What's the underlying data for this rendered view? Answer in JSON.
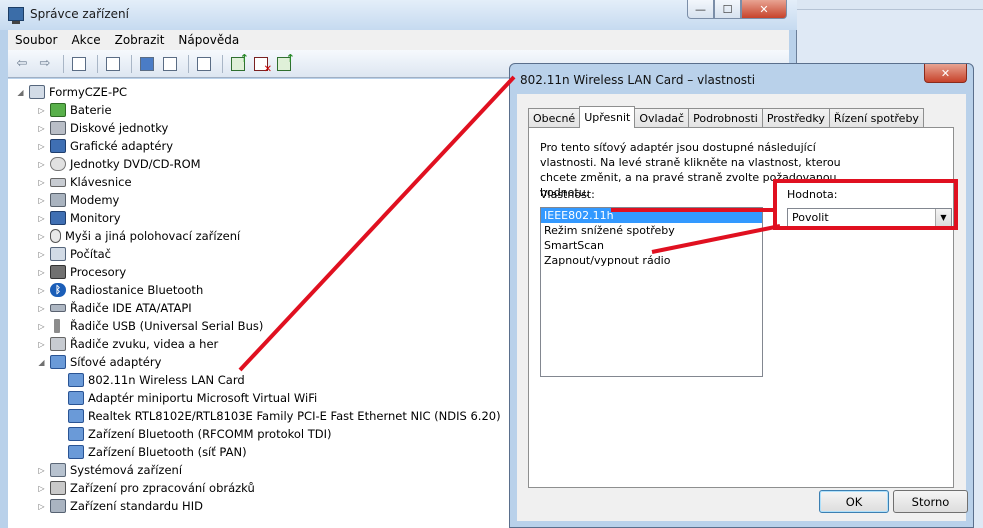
{
  "main_window": {
    "title": "Správce zařízení",
    "caption_buttons": {
      "minimize": "—",
      "maximize": "☐",
      "close": "✕"
    },
    "menu": [
      "Soubor",
      "Akce",
      "Zobrazit",
      "Nápověda"
    ],
    "toolbar_icons": [
      "back-arrow-icon",
      "forward-arrow-icon",
      "tree-view-icon",
      "properties-icon",
      "help-icon",
      "device-view-icon",
      "scan-hardware-icon",
      "update-driver-icon",
      "uninstall-icon",
      "enable-device-icon"
    ],
    "tree": {
      "root": "FormyCZE-PC",
      "categories": [
        "Baterie",
        "Diskové jednotky",
        "Grafické adaptéry",
        "Jednotky DVD/CD-ROM",
        "Klávesnice",
        "Modemy",
        "Monitory",
        "Myši a jiná polohovací zařízení",
        "Počítač",
        "Procesory",
        "Radiostanice Bluetooth",
        "Řadiče IDE ATA/ATAPI",
        "Řadiče USB (Universal Serial Bus)",
        "Řadiče zvuku, videa a her",
        "Síťové adaptéry"
      ],
      "network_children": [
        "802.11n Wireless LAN Card",
        "Adaptér miniportu Microsoft Virtual WiFi",
        "Realtek RTL8102E/RTL8103E Family PCI-E Fast Ethernet NIC (NDIS 6.20)",
        "Zařízení Bluetooth (RFCOMM protokol TDI)",
        "Zařízení Bluetooth (síť PAN)"
      ],
      "tail_categories": [
        "Systémová zařízení",
        "Zařízení pro zpracování obrázků",
        "Zařízení standardu HID"
      ]
    }
  },
  "dialog": {
    "title": "802.11n Wireless LAN Card – vlastnosti",
    "close_label": "✕",
    "tabs": [
      "Obecné",
      "Upřesnit",
      "Ovladač",
      "Podrobnosti",
      "Prostředky",
      "Řízení spotřeby"
    ],
    "active_tab": "Upřesnit",
    "description": "Pro tento síťový adaptér jsou dostupné následující vlastnosti. Na levé straně klikněte na vlastnost, kterou chcete změnit, a na pravé straně zvolte požadovanou hodnotu.",
    "property_label": "Vlastnost:",
    "properties": [
      "IEEE802.11h",
      "Režim snížené spotřeby",
      "SmartScan",
      "Zapnout/vypnout rádio"
    ],
    "selected_property": "IEEE802.11h",
    "value_label": "Hodnota:",
    "value": "Povolit",
    "ok_label": "OK",
    "cancel_label": "Storno"
  },
  "colors": {
    "annotation_red": "#e01020",
    "selection_blue": "#3399ff",
    "window_frame": "#b9d1ea"
  }
}
